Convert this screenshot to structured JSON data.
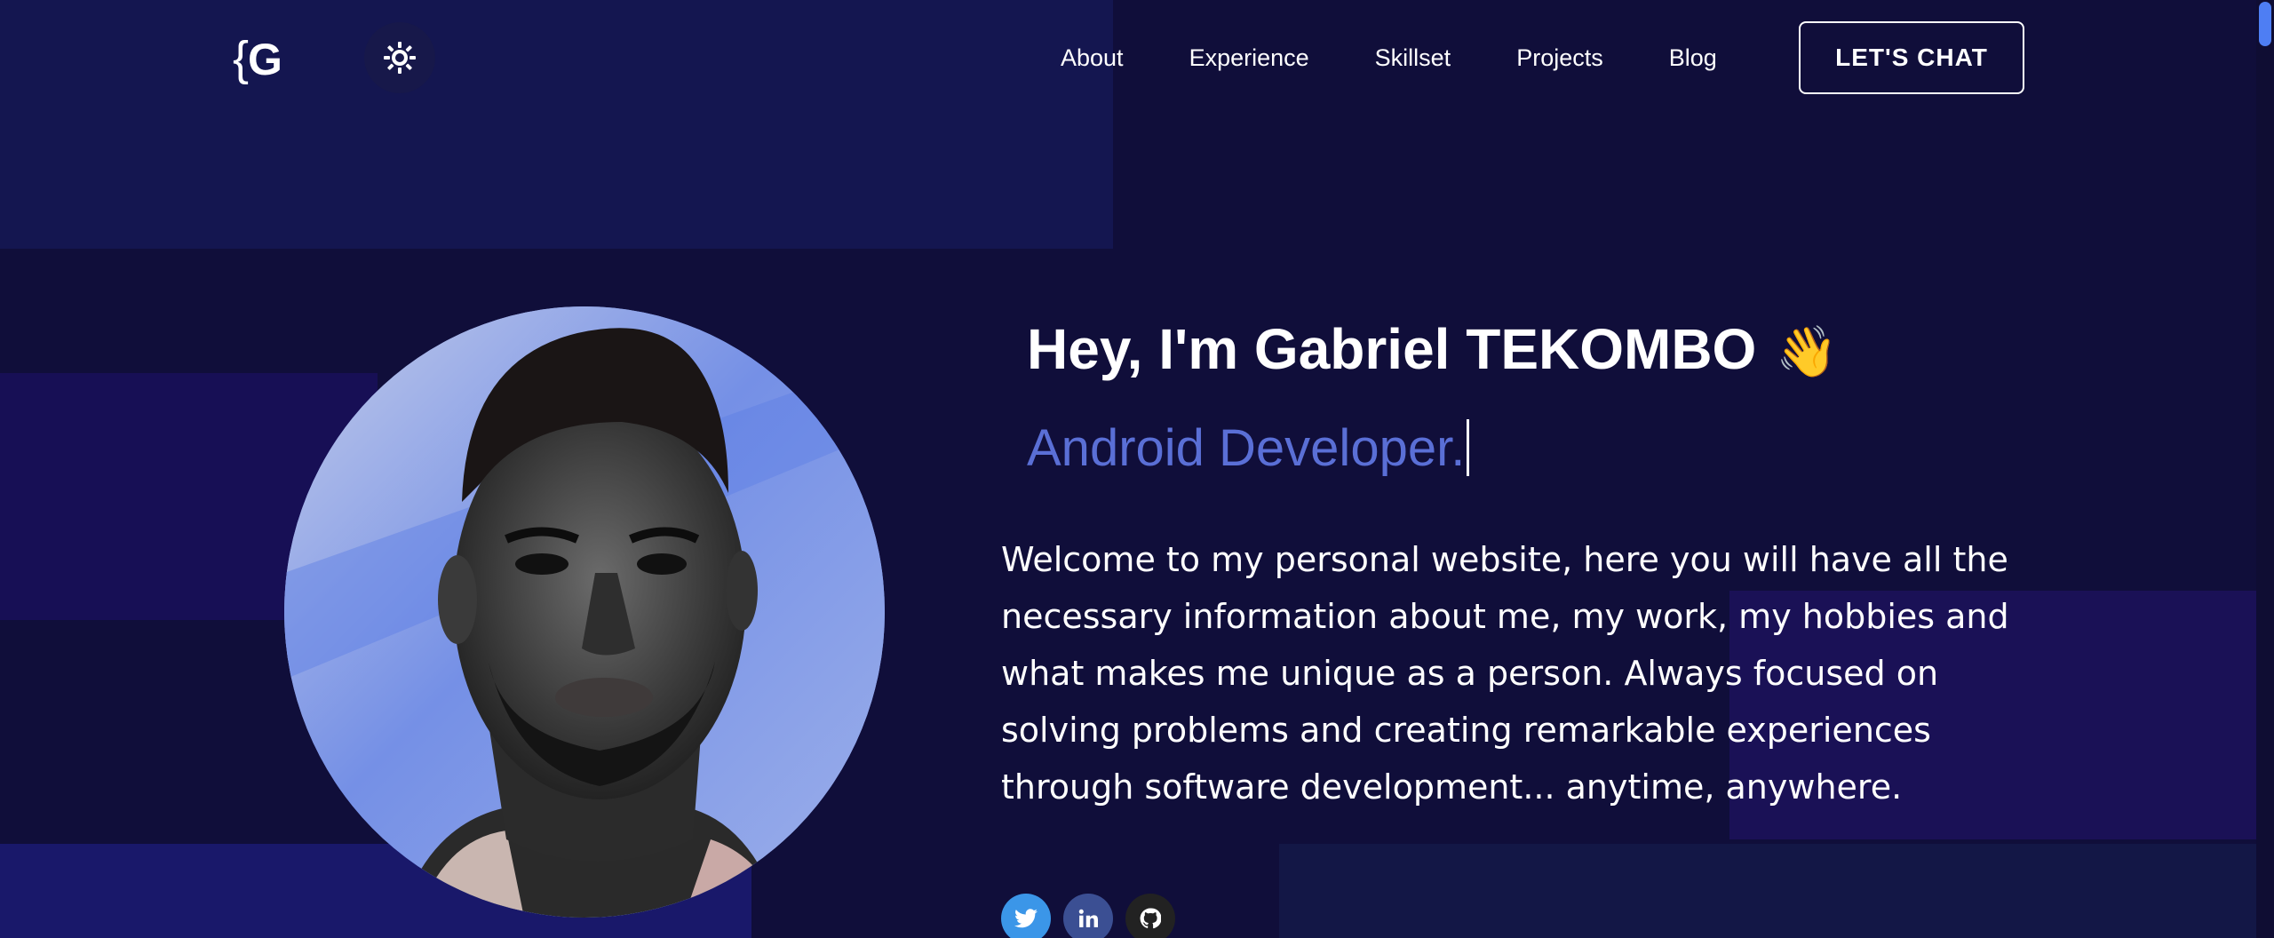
{
  "header": {
    "logo_brace": "{",
    "logo_letter": "G",
    "theme_toggle_icon": "sun-icon",
    "nav": [
      "About",
      "Experience",
      "Skillset",
      "Projects",
      "Blog"
    ],
    "cta_label": "LET'S CHAT"
  },
  "hero": {
    "greeting": "Hey, I'm Gabriel TEKOMBO",
    "wave_emoji": "👋",
    "role": "Android Developer.",
    "description": "Welcome to my personal website, here you will have all the necessary information about me, my work, my hobbies and what makes me unique as a person. Always focused on solving problems and creating remarkable experiences through software development... anytime, anywhere.",
    "portrait_icon": "profile-photo"
  },
  "social": [
    {
      "name": "twitter",
      "icon": "twitter-icon",
      "color": "#3b96e8"
    },
    {
      "name": "linkedin",
      "icon": "linkedin-icon",
      "color": "#3b4f93"
    },
    {
      "name": "github",
      "icon": "github-icon",
      "color": "#222222"
    }
  ],
  "colors": {
    "background": "#100e3a",
    "accent": "#5a6fd6",
    "scrollbar": "#4e7ef3"
  }
}
